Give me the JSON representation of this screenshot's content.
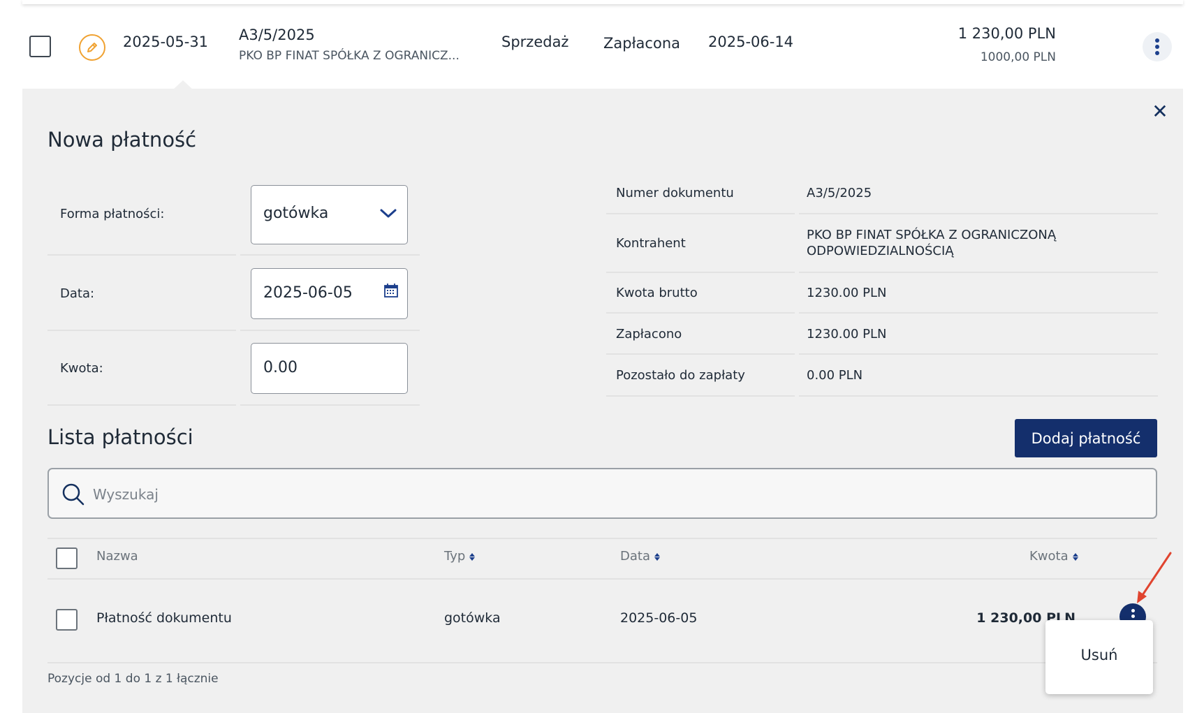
{
  "doc_row": {
    "date": "2025-05-31",
    "number": "A3/5/2025",
    "counterparty": "PKO BP FINAT SPÓŁKA Z OGRANICZ...",
    "type": "Sprzedaż",
    "status": "Zapłacona",
    "due_date": "2025-06-14",
    "gross": "1 230,00 PLN",
    "net": "1000,00 PLN"
  },
  "new_payment": {
    "title": "Nowa płatność",
    "method_label": "Forma płatności:",
    "method_value": "gotówka",
    "date_label": "Data:",
    "date_value": "2025-06-05",
    "amount_label": "Kwota:",
    "amount_value": "0.00"
  },
  "info": {
    "doc_number_label": "Numer dokumentu",
    "doc_number_value": "A3/5/2025",
    "counterparty_label": "Kontrahent",
    "counterparty_value_1": "PKO BP FINAT SPÓŁKA Z OGRANICZONĄ",
    "counterparty_value_2": "ODPOWIEDZIALNOŚCIĄ",
    "gross_label": "Kwota brutto",
    "gross_value": "1230.00 PLN",
    "paid_label": "Zapłacono",
    "paid_value": "1230.00 PLN",
    "remaining_label": "Pozostało do zapłaty",
    "remaining_value": "0.00 PLN"
  },
  "list": {
    "title": "Lista płatności",
    "add_button": "Dodaj płatność",
    "search_placeholder": "Wyszukaj",
    "columns": {
      "name": "Nazwa",
      "type": "Typ",
      "date": "Data",
      "amount": "Kwota"
    },
    "rows": [
      {
        "name": "Płatność dokumentu",
        "type": "gotówka",
        "date": "2025-06-05",
        "amount": "1 230,00 PLN"
      }
    ],
    "footer": "Pozycje od 1 do 1 z 1 łącznie",
    "menu_delete": "Usuń"
  },
  "colors": {
    "accent_navy": "#142f6c",
    "edit_orange": "#f0a232",
    "annotation_red": "#e0442f",
    "panel_bg": "#f0f0f0"
  }
}
